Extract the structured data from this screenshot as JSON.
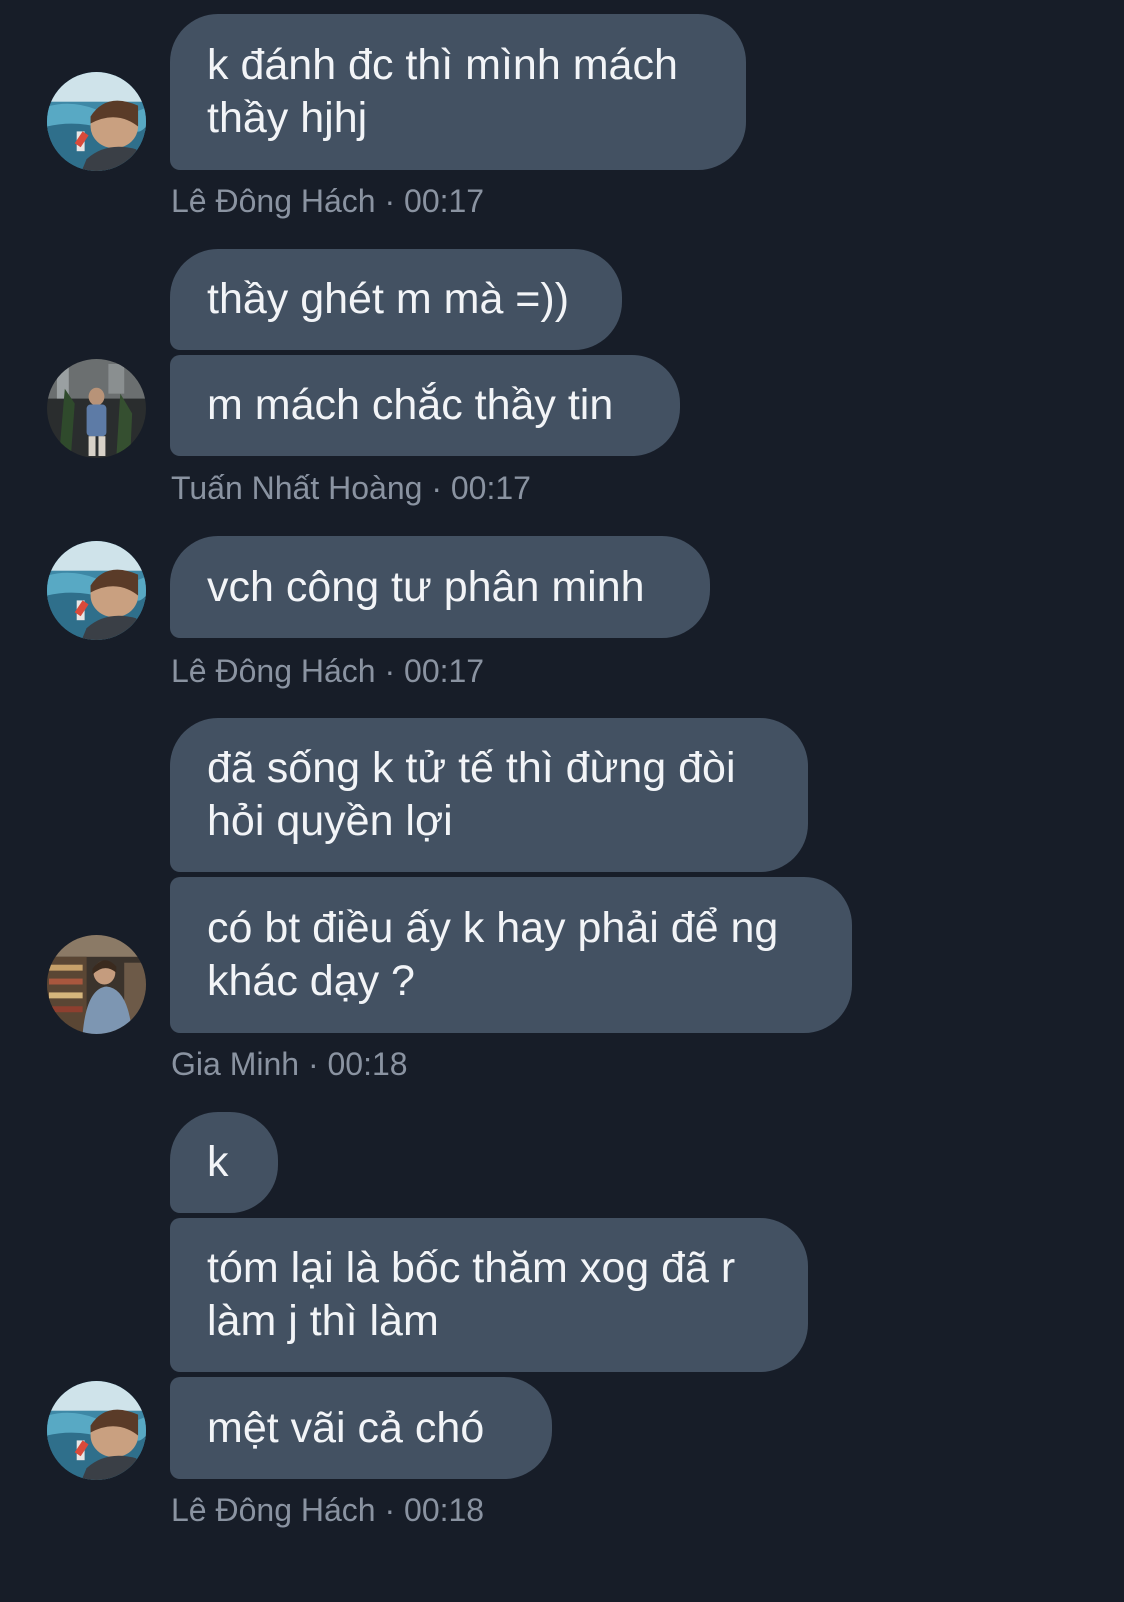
{
  "groups": [
    {
      "sender": "Lê Đông Hách",
      "time": "00:17",
      "avatar": "pool-avatar-icon",
      "messages": [
        {
          "lines": [
            "k đánh đc thì mình mách",
            "thầy hjhj"
          ]
        }
      ]
    },
    {
      "sender": "Tuấn Nhất Hoàng",
      "time": "00:17",
      "avatar": "street-avatar-icon",
      "messages": [
        {
          "lines": [
            "thầy ghét m mà =))"
          ]
        },
        {
          "lines": [
            "m mách chắc thầy tin"
          ]
        }
      ]
    },
    {
      "sender": "Lê Đông Hách",
      "time": "00:17",
      "avatar": "pool-avatar-icon",
      "messages": [
        {
          "lines": [
            "vch công tư phân minh"
          ]
        }
      ]
    },
    {
      "sender": "Gia Minh",
      "time": "00:18",
      "avatar": "store-avatar-icon",
      "messages": [
        {
          "lines": [
            "đã sống k tử tế thì đừng đòi",
            "hỏi quyền lợi"
          ]
        },
        {
          "lines": [
            "có bt điều ấy k hay phải để ng",
            "khác dạy ?"
          ]
        }
      ]
    },
    {
      "sender": "Lê Đông Hách",
      "time": "00:18",
      "avatar": "pool-avatar-icon",
      "messages": [
        {
          "lines": [
            "k"
          ]
        },
        {
          "lines": [
            "tóm lại là bốc thăm xog đã r",
            "làm j thì làm"
          ]
        },
        {
          "lines": [
            "mệt vãi cả chó"
          ]
        }
      ]
    }
  ],
  "meta_separator": "·",
  "colors": {
    "background": "#171d28",
    "bubble": "#435162",
    "text": "#f2f4f7",
    "meta": "#8a93a1"
  }
}
